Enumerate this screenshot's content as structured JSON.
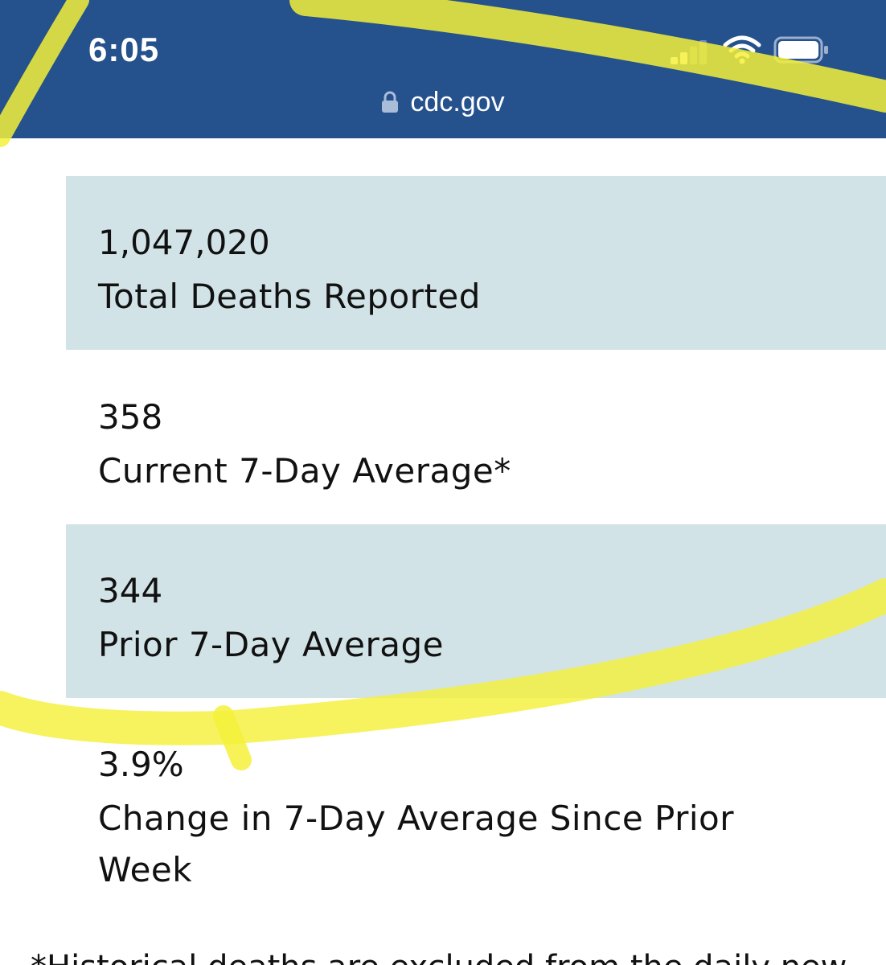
{
  "status_bar": {
    "time": "6:05",
    "signal_bars_active": 2,
    "signal_bars_total": 4
  },
  "browser": {
    "url": "cdc.gov",
    "lock_icon": "lock-icon"
  },
  "stats": [
    {
      "value": "1,047,020",
      "label": "Total Deaths Reported"
    },
    {
      "value": "358",
      "label": "Current 7-Day Average*"
    },
    {
      "value": "344",
      "label": "Prior 7-Day Average"
    },
    {
      "value": "3.9%",
      "label": "Change in 7-Day Average Since Prior Week"
    }
  ],
  "footnote": "*Historical deaths are excluded from the daily new",
  "colors": {
    "header_bg": "#25518d",
    "shaded_row_bg": "#d1e3e7",
    "highlighter": "#f4f03a"
  }
}
